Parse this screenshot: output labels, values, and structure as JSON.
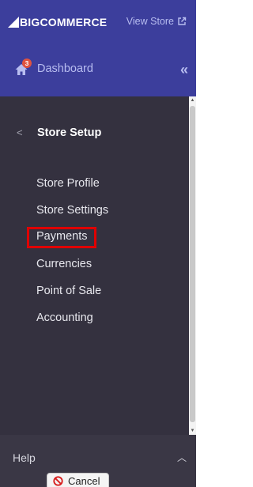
{
  "header": {
    "brand_prefix": "BIG",
    "brand_suffix": "COMMERCE",
    "view_store_label": "View Store",
    "dashboard_label": "Dashboard",
    "dashboard_badge": "3",
    "accent_color": "#3c3e9c"
  },
  "sidebar": {
    "section_title": "Store Setup",
    "items": [
      {
        "label": "Store Profile"
      },
      {
        "label": "Store Settings"
      },
      {
        "label": "Payments",
        "highlighted": true
      },
      {
        "label": "Currencies"
      },
      {
        "label": "Point of Sale"
      },
      {
        "label": "Accounting"
      }
    ]
  },
  "footer": {
    "help_label": "Help"
  },
  "cancel_button": {
    "label": "Cancel"
  },
  "icons": {
    "home": "home-icon",
    "external_link": "external-link-icon",
    "collapse": "double-chevron-left-icon",
    "back": "chevron-left-icon",
    "help_toggle": "chevron-up-icon",
    "cancel": "no-entry-icon"
  }
}
